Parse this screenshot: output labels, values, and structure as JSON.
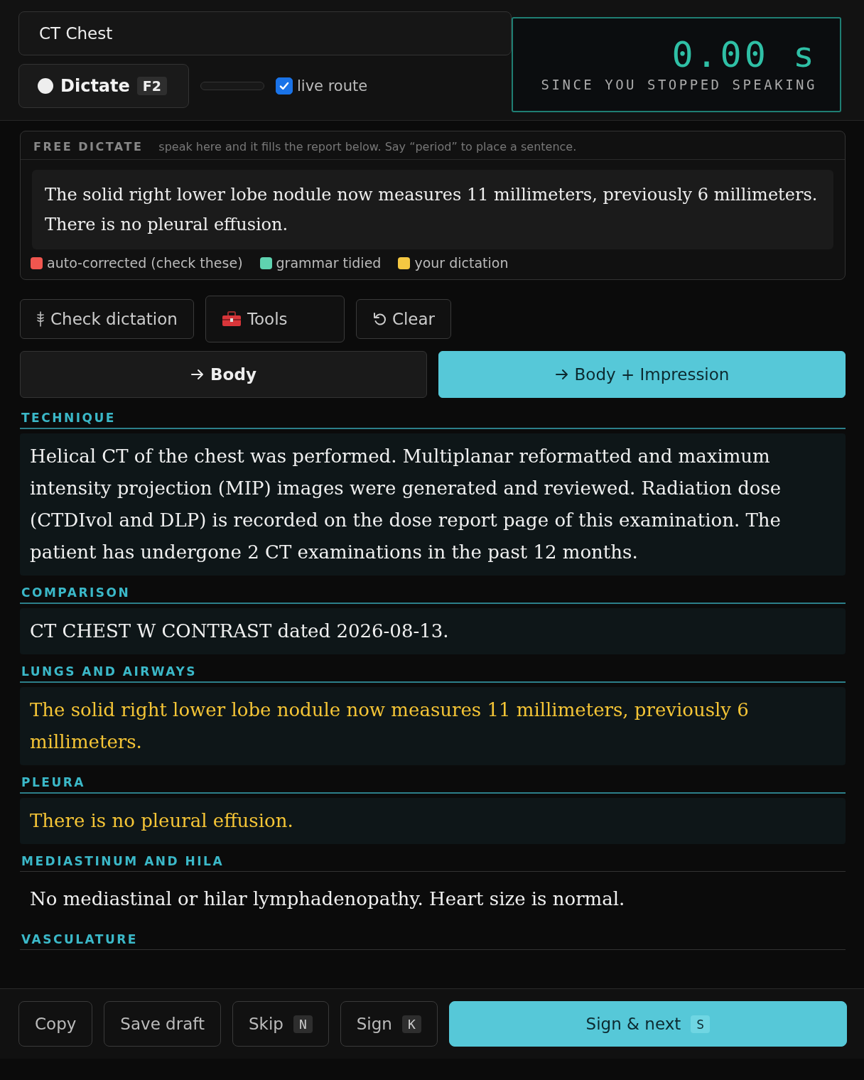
{
  "study_select": {
    "value": "CT Chest"
  },
  "dictate_button": {
    "label": "Dictate",
    "shortcut": "F2",
    "recording": false
  },
  "live_route": {
    "label": "live route",
    "checked": true
  },
  "timer": {
    "value": "0.00 s",
    "caption": "SINCE YOU STOPPED SPEAKING"
  },
  "free_dictate": {
    "title": "FREE DICTATE",
    "hint": "speak here and it fills the report below. Say “period” to place a sentence.",
    "text": "The solid right lower lobe nodule now measures 11 millimeters, previously 6 millimeters. There is no pleural effusion.",
    "legend": [
      {
        "label": "auto-corrected (check these)",
        "color": "#f0564f"
      },
      {
        "label": "grammar tidied",
        "color": "#5fd3b0"
      },
      {
        "label": "your dictation",
        "color": "#f5c842"
      }
    ]
  },
  "tool_buttons": [
    {
      "label": "Check dictation",
      "kind": "check"
    },
    {
      "label": "Tools",
      "kind": "tools"
    },
    {
      "label": "Clear",
      "kind": "clear"
    }
  ],
  "route_buttons": [
    {
      "label": "Body",
      "selected": false
    },
    {
      "label": "Body + Impression",
      "selected": true
    }
  ],
  "sections": [
    {
      "heading": "TECHNIQUE",
      "text": "Helical CT of the chest was performed. Multiplanar reformatted and maximum intensity projection (MIP) images were generated and reviewed. Radiation dose (CTDIvol and DLP) is recorded on the dose report page of this examination. The patient has undergone 2 CT examinations in the past 12 months.",
      "kind": "template"
    },
    {
      "heading": "COMPARISON",
      "text": "CT CHEST W CONTRAST dated 2026-08-13.",
      "kind": "template"
    },
    {
      "heading": "LUNGS AND AIRWAYS",
      "text": "The solid right lower lobe nodule now measures 11 millimeters, previously 6 millimeters.",
      "kind": "dictated"
    },
    {
      "heading": "PLEURA",
      "text": "There is no pleural effusion.",
      "kind": "dictated"
    },
    {
      "heading": "MEDIASTINUM AND HILA",
      "text": "No mediastinal or hilar lymphadenopathy. Heart size is normal.",
      "kind": "default"
    },
    {
      "heading": "VASCULATURE",
      "kind": "cut"
    }
  ],
  "footer_buttons": [
    {
      "label": "Copy",
      "primary": false
    },
    {
      "label": "Save draft",
      "primary": false
    },
    {
      "label": "Skip",
      "shortcut": "N",
      "primary": false
    },
    {
      "label": "Sign",
      "shortcut": "K",
      "primary": false
    },
    {
      "label": "Sign & next",
      "shortcut": "S",
      "primary": true
    }
  ]
}
